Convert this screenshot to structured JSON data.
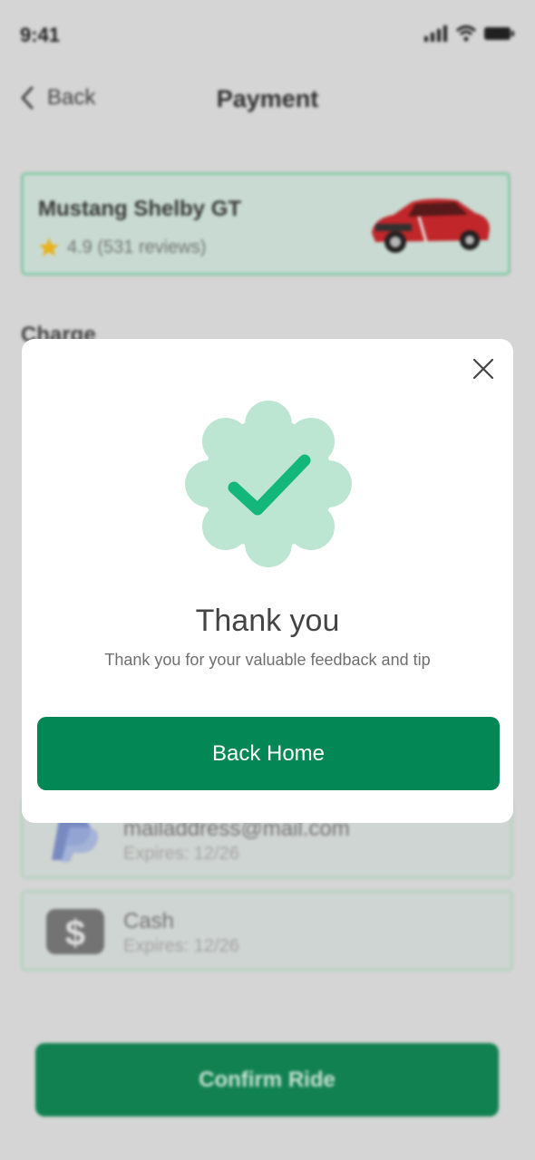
{
  "status_bar": {
    "time": "9:41"
  },
  "header": {
    "back_label": "Back",
    "title": "Payment"
  },
  "car": {
    "name": "Mustang Shelby GT",
    "rating": "4.9 (531 reviews)"
  },
  "charge": {
    "label": "Charge"
  },
  "payment_methods": [
    {
      "title": "mailaddress@mail.com",
      "subtitle": "Expires: 12/26",
      "icon": "paypal-icon"
    },
    {
      "title": "Cash",
      "subtitle": "Expires: 12/26",
      "icon": "cash-icon"
    }
  ],
  "footer": {
    "confirm_label": "Confirm Ride"
  },
  "modal": {
    "title": "Thank you",
    "message": "Thank you for your valuable feedback and tip",
    "button_label": "Back Home"
  },
  "colors": {
    "primary": "#038855",
    "badge_bg": "#bde6d2",
    "check": "#13b67b",
    "card_border": "#8fd0ad"
  }
}
